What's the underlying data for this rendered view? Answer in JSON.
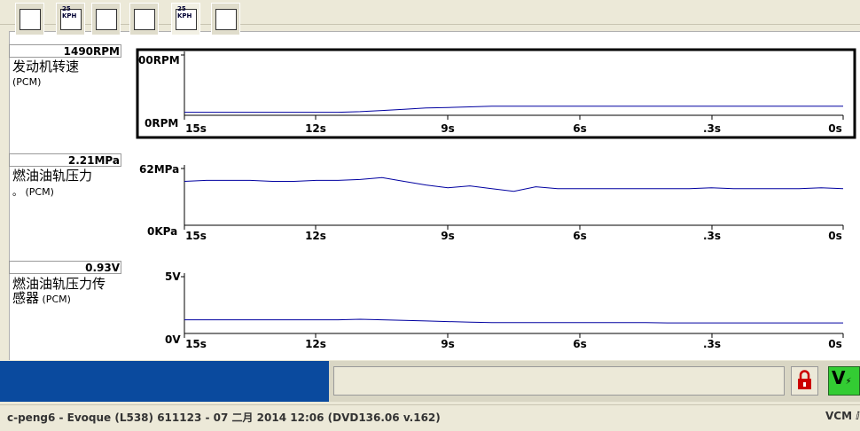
{
  "graphs": [
    {
      "value": "1490RPM",
      "name_line1": "发动机转速",
      "name_line2": "",
      "source": "(PCM)",
      "y_max_label": "00RPM",
      "y_min_label": "0RPM",
      "x_ticks": [
        "15s",
        "12s",
        "9s",
        "6s",
        ".3s",
        "0s"
      ],
      "selected": true
    },
    {
      "value": "2.21MPa",
      "name_line1": "燃油油轨压力",
      "name_line2": "。",
      "source": "(PCM)",
      "y_max_label": "62MPa",
      "y_min_label": "0KPa",
      "x_ticks": [
        "15s",
        "12s",
        "9s",
        "6s",
        ".3s",
        "0s"
      ],
      "selected": false
    },
    {
      "value": "0.93V",
      "name_line1": "燃油油轨压力传",
      "name_line2": "感器",
      "source": "(PCM)",
      "y_max_label": "5V",
      "y_min_label": "0V",
      "x_ticks": [
        "15s",
        "12s",
        "9s",
        "6s",
        ".3s",
        "0s"
      ],
      "selected": false
    }
  ],
  "chart_data": [
    {
      "type": "line",
      "x": [
        15,
        14.5,
        14,
        13.5,
        13,
        12.5,
        12,
        11.5,
        11,
        10.5,
        10,
        9.5,
        9,
        8.5,
        8,
        7.5,
        7,
        6.5,
        6,
        5.5,
        5,
        4.5,
        4,
        3.5,
        3,
        2.5,
        2,
        1.5,
        1,
        0.5,
        0
      ],
      "series": [
        {
          "values": [
            5,
            5,
            5,
            5,
            5,
            5,
            5,
            5,
            6,
            8,
            10,
            12,
            13,
            14,
            15,
            15,
            15,
            15,
            15,
            15,
            15,
            15,
            15,
            15,
            15,
            15,
            15,
            15,
            15,
            15,
            15
          ]
        }
      ],
      "xlabel": "",
      "ylabel": "",
      "y_ticks": [
        "00RPM",
        "0RPM"
      ],
      "x_ticks": [
        "15s",
        "12s",
        "9s",
        "6s",
        ".3s",
        "0s"
      ],
      "ylim": [
        0,
        100
      ]
    },
    {
      "type": "line",
      "x": [
        15,
        14.5,
        14,
        13.5,
        13,
        12.5,
        12,
        11.5,
        11,
        10.5,
        10,
        9.5,
        9,
        8.5,
        8,
        7.5,
        7,
        6.5,
        6,
        5.5,
        5,
        4.5,
        4,
        3.5,
        3,
        2.5,
        2,
        1.5,
        1,
        0.5,
        0
      ],
      "series": [
        {
          "values": [
            48,
            49,
            49,
            49,
            48,
            48,
            49,
            49,
            50,
            52,
            48,
            44,
            41,
            43,
            40,
            37,
            42,
            40,
            40,
            40,
            40,
            40,
            40,
            40,
            41,
            40,
            40,
            40,
            40,
            41,
            40
          ]
        }
      ],
      "xlabel": "",
      "ylabel": "",
      "y_ticks": [
        "62MPa",
        "0KPa"
      ],
      "x_ticks": [
        "15s",
        "12s",
        "9s",
        "6s",
        ".3s",
        "0s"
      ],
      "ylim": [
        0,
        62
      ]
    },
    {
      "type": "line",
      "x": [
        15,
        14.5,
        14,
        13.5,
        13,
        12.5,
        12,
        11.5,
        11,
        10.5,
        10,
        9.5,
        9,
        8.5,
        8,
        7.5,
        7,
        6.5,
        6,
        5.5,
        5,
        4.5,
        4,
        3.5,
        3,
        2.5,
        2,
        1.5,
        1,
        0.5,
        0
      ],
      "series": [
        {
          "values": [
            1.2,
            1.2,
            1.2,
            1.2,
            1.2,
            1.2,
            1.2,
            1.2,
            1.25,
            1.2,
            1.15,
            1.1,
            1.05,
            1,
            0.95,
            0.95,
            0.95,
            0.95,
            0.95,
            0.95,
            0.95,
            0.95,
            0.93,
            0.93,
            0.93,
            0.93,
            0.93,
            0.93,
            0.93,
            0.93,
            0.93
          ]
        }
      ],
      "xlabel": "",
      "ylabel": "",
      "y_ticks": [
        "5V",
        "0V"
      ],
      "x_ticks": [
        "15s",
        "12s",
        "9s",
        "6s",
        ".3s",
        "0s"
      ],
      "ylim": [
        0,
        5
      ]
    }
  ],
  "toolbar": {
    "buttons": [
      {
        "name": "monitor-button",
        "icon": "hand-clipboard-icon"
      },
      {
        "name": "speed-graph-button",
        "icon": "kph-list-icon",
        "badge": "25 KPH"
      },
      {
        "name": "datalogger-button",
        "icon": "hand-bars-icon"
      },
      {
        "name": "network-button",
        "icon": "globe-list-icon"
      },
      {
        "name": "speed-wave-button",
        "icon": "kph-wave-icon",
        "badge": "25 KPH"
      },
      {
        "name": "diagnostic-button",
        "icon": "gears-icon"
      }
    ]
  },
  "status": {
    "session_text": "c-peng6 - Evoque (L538) 611123 - 07 二月 2014 12:06 (DVD136.06 v.162)",
    "right_text": "VCM ⅈ"
  },
  "colors": {
    "trace": "#0000a0",
    "vcm_button": "#33cc33",
    "lock": "#cc0000",
    "taskbar": "#0a4a9e"
  }
}
